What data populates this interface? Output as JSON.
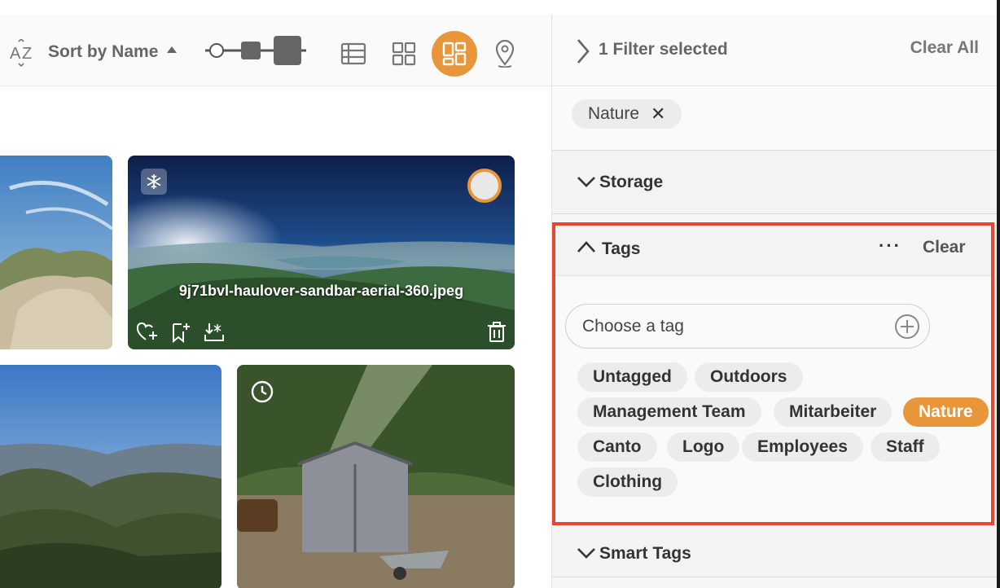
{
  "toolbar": {
    "sort_label": "Sort by Name",
    "views": [
      {
        "name": "list-view",
        "active": false
      },
      {
        "name": "grid-view",
        "active": false
      },
      {
        "name": "masonry-view",
        "active": true
      },
      {
        "name": "map-view",
        "active": false
      }
    ]
  },
  "grid": {
    "tiles": [
      {
        "name": "tile-1",
        "filename": ""
      },
      {
        "name": "tile-2",
        "filename": "9j71bvl-haulover-sandbar-aerial-360.jpeg"
      },
      {
        "name": "tile-3",
        "filename": ""
      },
      {
        "name": "tile-4",
        "filename": ""
      }
    ]
  },
  "filters": {
    "summary": "1 Filter selected",
    "clear_all": "Clear All",
    "active": [
      {
        "label": "Nature"
      }
    ]
  },
  "sections": {
    "storage": "Storage",
    "tags": {
      "title": "Tags",
      "more": "···",
      "clear": "Clear",
      "input_placeholder": "Choose a tag",
      "items": [
        {
          "label": "Untagged",
          "selected": false
        },
        {
          "label": "Outdoors",
          "selected": false
        },
        {
          "label": "Management Team",
          "selected": false
        },
        {
          "label": "Mitarbeiter",
          "selected": false
        },
        {
          "label": "Nature",
          "selected": true
        },
        {
          "label": "Canto",
          "selected": false
        },
        {
          "label": "Logo",
          "selected": false
        },
        {
          "label": "Employees",
          "selected": false
        },
        {
          "label": "Staff",
          "selected": false
        },
        {
          "label": "Clothing",
          "selected": false
        }
      ]
    },
    "smart_tags": "Smart Tags"
  },
  "colors": {
    "accent": "#e9963a",
    "highlight_border": "#e8472d"
  }
}
